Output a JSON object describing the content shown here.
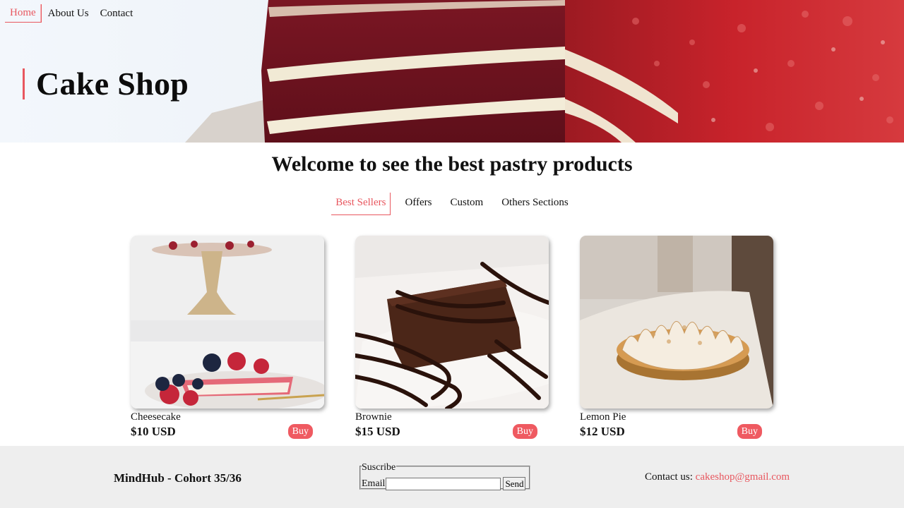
{
  "nav": {
    "items": [
      {
        "label": "Home",
        "active": true
      },
      {
        "label": "About Us",
        "active": false
      },
      {
        "label": "Contact",
        "active": false
      }
    ]
  },
  "hero": {
    "title": "Cake Shop",
    "image_icon": "red-velvet-cake-photo"
  },
  "main": {
    "welcome": "Welcome to see the best pastry products",
    "tabs": [
      {
        "label": "Best Sellers",
        "active": true
      },
      {
        "label": "Offers",
        "active": false
      },
      {
        "label": "Custom",
        "active": false
      },
      {
        "label": "Others Sections",
        "active": false
      }
    ],
    "products": [
      {
        "name": "Cheesecake",
        "price": "$10 USD",
        "buy_label": "Buy",
        "image_icon": "cheesecake-photo"
      },
      {
        "name": "Brownie",
        "price": "$15 USD",
        "buy_label": "Buy",
        "image_icon": "brownie-photo"
      },
      {
        "name": "Lemon Pie",
        "price": "$12 USD",
        "buy_label": "Buy",
        "image_icon": "lemon-pie-photo"
      }
    ]
  },
  "footer": {
    "brand": "MindHub - Cohort 35/36",
    "subscribe": {
      "legend": "Suscribe",
      "email_label": "Email",
      "email_value": "",
      "send_label": "Send"
    },
    "contact_label": "Contact us:",
    "contact_email": "cakeshop@gmail.com"
  },
  "colors": {
    "accent": "#e8575f",
    "buy_button": "#ef5a61",
    "footer_bg": "#eeeeee"
  }
}
